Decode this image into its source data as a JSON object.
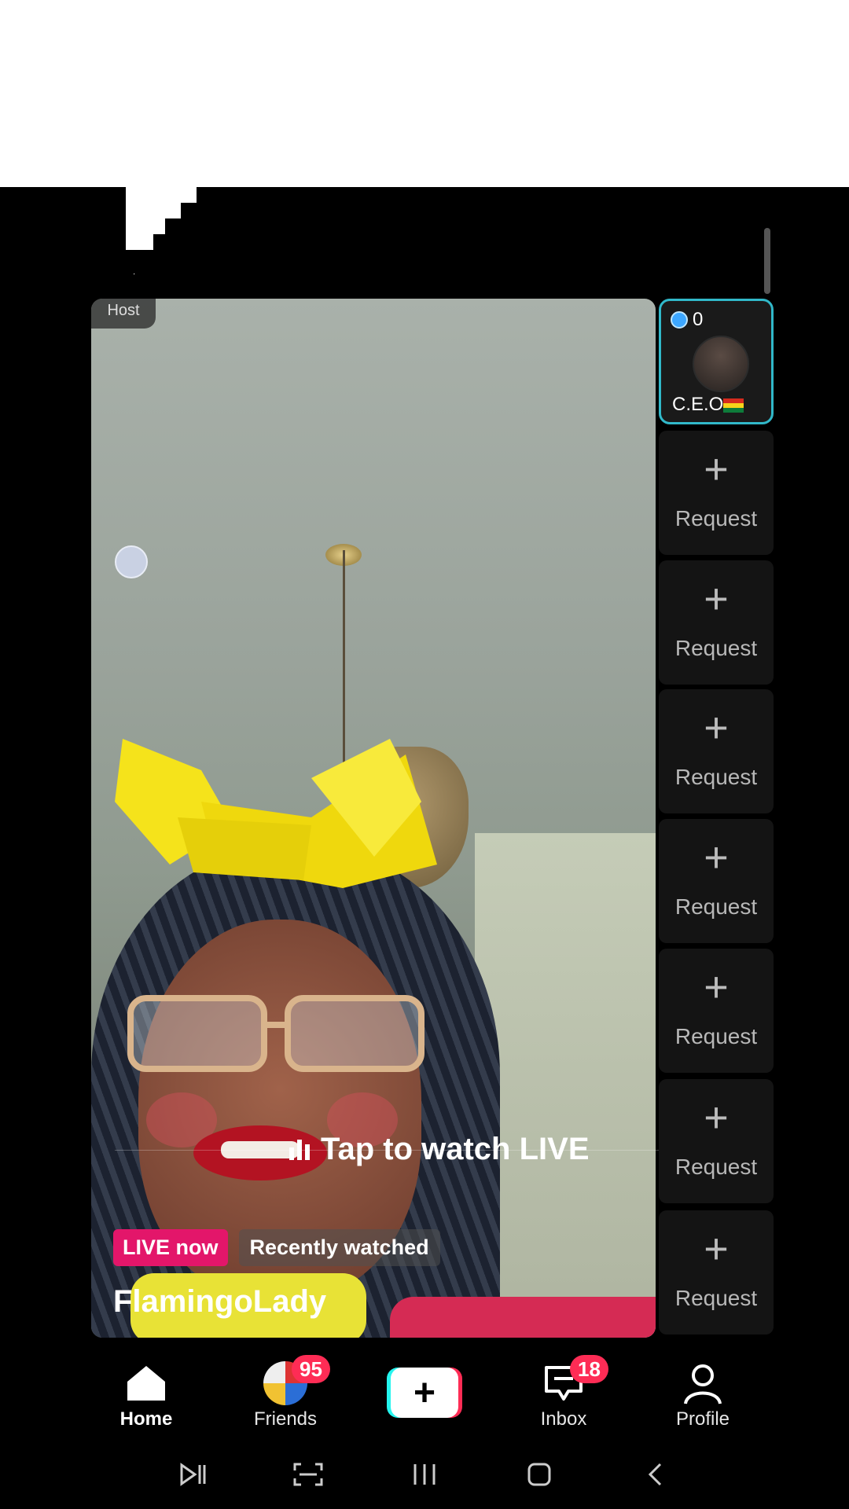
{
  "stream": {
    "host_tag": "Host",
    "tap_to_watch": "Tap to watch LIVE",
    "live_chip": "LIVE now",
    "recent_chip": "Recently watched",
    "username": "FlamingoLady"
  },
  "guest": {
    "score": "0",
    "name": "C.E.O",
    "flag": "ghana-flag"
  },
  "request_slots": [
    "Request",
    "Request",
    "Request",
    "Request",
    "Request",
    "Request",
    "Request"
  ],
  "nav": {
    "home": "Home",
    "friends": "Friends",
    "friends_badge": "95",
    "inbox": "Inbox",
    "inbox_badge": "18",
    "profile": "Profile",
    "create_glyph": "+"
  },
  "colors": {
    "live_pink": "#e3166a",
    "guest_border": "#31b8c9",
    "badge_red": "#fe2c55",
    "create_cyan": "#25f4ee"
  },
  "system_nav": [
    "media-icon",
    "screenshot-icon",
    "recents-icon",
    "home-icon",
    "back-icon"
  ]
}
